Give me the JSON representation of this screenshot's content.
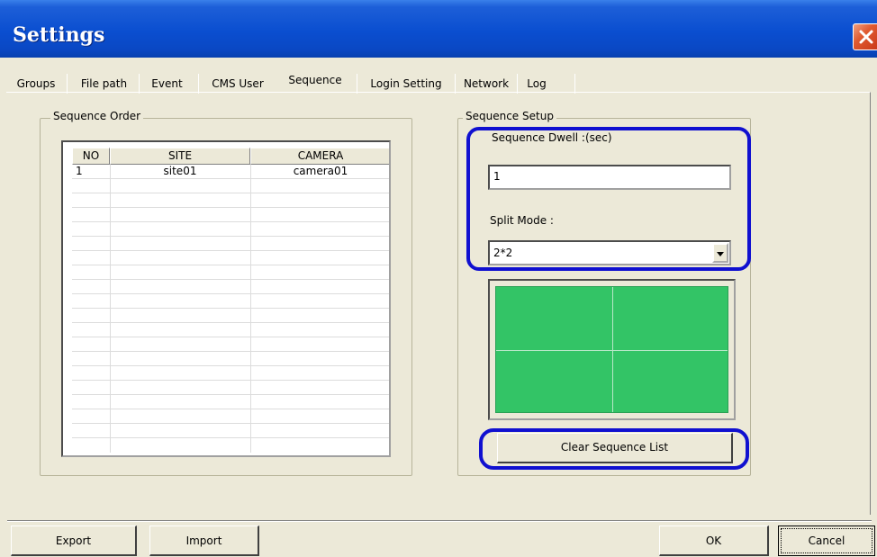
{
  "window": {
    "title": "Settings",
    "close_icon": "close-icon"
  },
  "tabs": [
    "Groups",
    "File path",
    "Event",
    "CMS User",
    "Sequence",
    "Login Setting",
    "Network",
    "Log"
  ],
  "active_tab": "Sequence",
  "sequence_order": {
    "title": "Sequence Order",
    "columns": [
      "NO",
      "SITE",
      "CAMERA"
    ],
    "rows": [
      {
        "no": "1",
        "site": "site01",
        "camera": "camera01"
      }
    ]
  },
  "sequence_setup": {
    "title": "Sequence Setup",
    "dwell_label": "Sequence Dwell :(sec)",
    "dwell_value": "1",
    "split_label": "Split Mode :",
    "split_value": "2*2",
    "clear_button": "Clear Sequence List"
  },
  "footer": {
    "export": "Export",
    "import": "Import",
    "ok": "OK",
    "cancel": "Cancel"
  },
  "colors": {
    "title_bar": "#0a4ed0",
    "highlight": "#1010d0",
    "preview_green": "#33c466"
  }
}
